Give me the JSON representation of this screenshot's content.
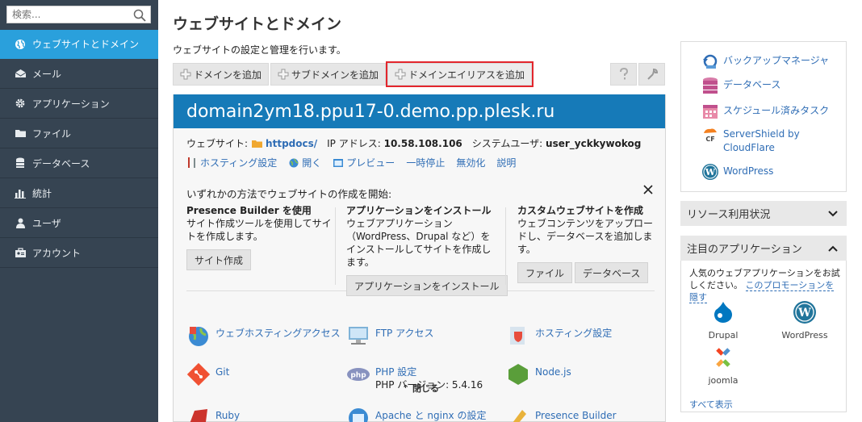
{
  "sidebar": {
    "search_placeholder": "検索...",
    "items": [
      {
        "label": "ウェブサイトとドメイン",
        "icon": "globe-icon",
        "active": true
      },
      {
        "label": "メール",
        "icon": "mail-icon"
      },
      {
        "label": "アプリケーション",
        "icon": "gear-icon"
      },
      {
        "label": "ファイル",
        "icon": "folder-icon"
      },
      {
        "label": "データベース",
        "icon": "database-icon"
      },
      {
        "label": "統計",
        "icon": "bar-chart-icon"
      },
      {
        "label": "ユーザ",
        "icon": "user-icon"
      },
      {
        "label": "アカウント",
        "icon": "account-icon"
      }
    ]
  },
  "main": {
    "title": "ウェブサイトとドメイン",
    "description": "ウェブサイトの設定と管理を行います。",
    "toolbar": {
      "add_domain": "ドメインを追加",
      "add_subdomain": "サブドメインを追加",
      "add_alias": "ドメインエイリアスを追加"
    },
    "domain": {
      "name": "domain2ym18.ppu17-0.demo.pp.plesk.ru",
      "website_label": "ウェブサイト:",
      "website_folder": "httpdocs/",
      "ip_label": "IP アドレス:",
      "ip": "10.58.108.106",
      "sysuser_label": "システムユーザ:",
      "sysuser": "user_yckkywokog",
      "links": {
        "hosting": "ホスティング設定",
        "open": "開く",
        "preview": "プレビュー",
        "suspend": "一時停止",
        "disable": "無効化",
        "description": "説明"
      }
    },
    "create": {
      "title": "いずれかの方法でウェブサイトの作成を開始:",
      "col1": {
        "heading": "Presence Builder を使用",
        "text": "サイト作成ツールを使用してサイトを作成します。",
        "button": "サイト作成"
      },
      "col2": {
        "heading": "アプリケーションをインストール",
        "text": "ウェブアプリケーション（WordPress、Drupal など）をインストールしてサイトを作成します。",
        "button": "アプリケーションをインストール"
      },
      "col3": {
        "heading": "カスタムウェブサイトを作成",
        "text": "ウェブコンテンツをアップロードし、データベースを追加します。",
        "button1": "ファイル",
        "button2": "データベース"
      },
      "collapse": "閉じる"
    },
    "apps": {
      "web_hosting_access": "ウェブホスティングアクセス",
      "ftp_access": "FTP アクセス",
      "hosting_settings": "ホスティング設定",
      "git": "Git",
      "php_settings": "PHP 設定",
      "php_version": "PHP バージョン: 5.4.16",
      "nodejs": "Node.js",
      "ruby": "Ruby",
      "apache_nginx": "Apache と nginx の設定",
      "presence_builder": "Presence Builder"
    }
  },
  "right": {
    "quick": {
      "backup": "バックアップマネージャ",
      "database": "データベース",
      "scheduled": "スケジュール済みタスク",
      "servershield": "ServerShield by CloudFlare",
      "wordpress": "WordPress"
    },
    "resource_usage": "リソース利用状況",
    "featured": {
      "title": "注目のアプリケーション",
      "text": "人気のウェブアプリケーションをお試しください。",
      "promo_link": "このプロモーションを隠す",
      "drupal": "Drupal",
      "wordpress": "WordPress",
      "joomla": "joomla",
      "show_all": "すべて表示"
    }
  }
}
